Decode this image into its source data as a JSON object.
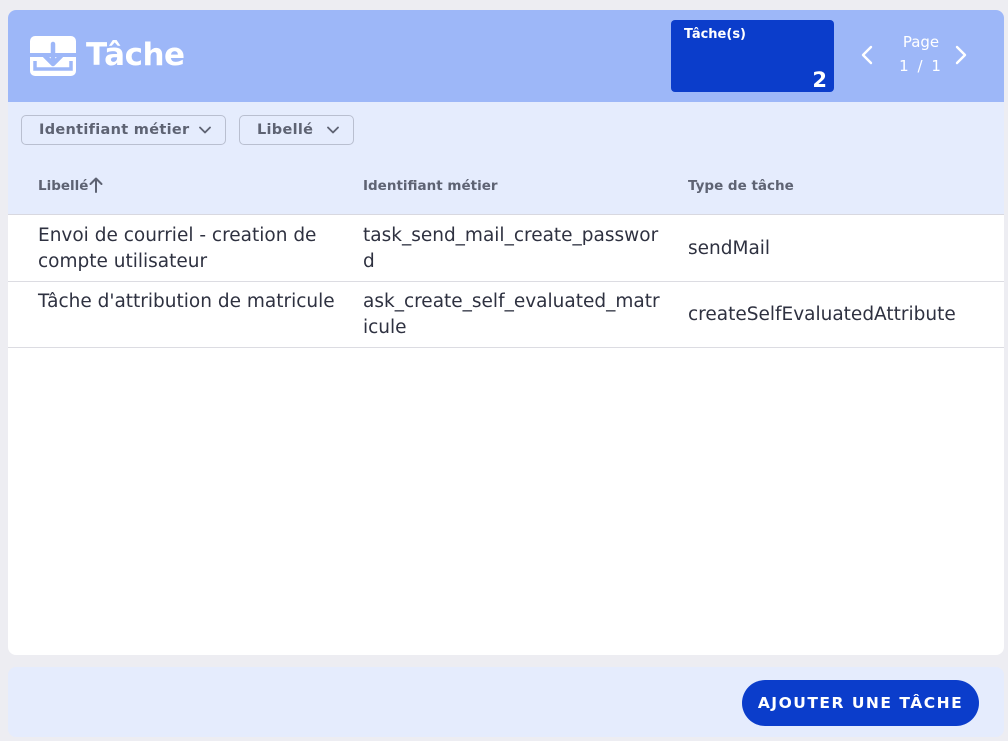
{
  "header": {
    "title": "Tâche",
    "title_icon": "download-tray-icon",
    "count_label": "Tâche(s)",
    "count_value": "2",
    "pager": {
      "label": "Page",
      "current": "1",
      "separator": "/",
      "total": "1"
    }
  },
  "filters": [
    {
      "label": "Identifiant métier",
      "icon": "chevron-down-icon"
    },
    {
      "label": "Libellé",
      "icon": "chevron-down-icon"
    }
  ],
  "table": {
    "columns": [
      "Libellé",
      "Identifiant métier",
      "Type de tâche"
    ],
    "sort_icon": "arrow-up-icon",
    "rows": [
      {
        "libelle": "Envoi de courriel - creation de compte utilisateur",
        "identifiant": "task_send_mail_create_password",
        "type": "sendMail"
      },
      {
        "libelle": "Tâche d'attribution de matricule",
        "identifiant": "ask_create_self_evaluated_matricule",
        "type": "createSelfEvaluatedAttribute"
      }
    ]
  },
  "footer": {
    "add_button_label": "AJOUTER UNE TÂCHE"
  },
  "colors": {
    "header_bg": "#9db7f8",
    "accent": "#0b3dcb",
    "filter_bg": "#e5ecfd"
  }
}
